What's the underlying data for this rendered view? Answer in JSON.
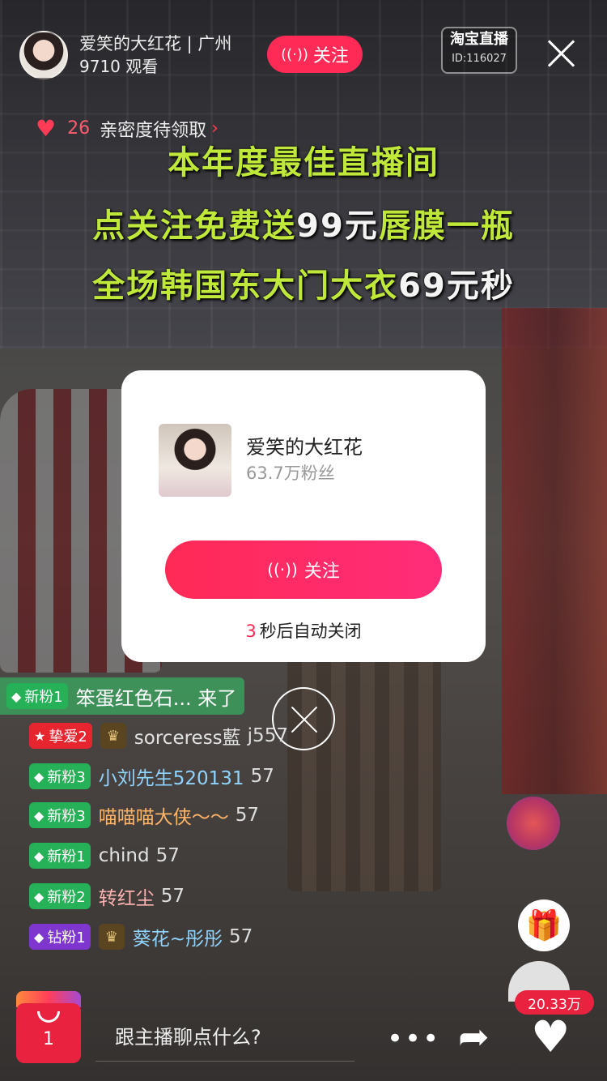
{
  "host": {
    "name": "爱笑的大红花 | 广州",
    "viewers": "9710 观看",
    "follow_label": "关注"
  },
  "platform": {
    "logo_text": "淘宝直播",
    "room_id": "ID:116027"
  },
  "intimacy": {
    "count": "26",
    "text": "亲密度待领取"
  },
  "banner": {
    "line1": "本年度最佳直播间",
    "line2_a": "点关注免费送",
    "line2_b": "99元",
    "line2_c": "唇膜一瓶",
    "line3_a": "全场韩国东大门大衣",
    "line3_b": "69元秒"
  },
  "modal": {
    "name": "爱笑的大红花",
    "fans": "63.7万粉丝",
    "follow_label": "关注",
    "countdown": "3",
    "countdown_text": "秒后自动关闭"
  },
  "chat": {
    "first": {
      "badge": "新粉1",
      "text": "笨蛋红色石... 来了"
    },
    "messages": [
      {
        "badge": "挚爱2",
        "user": "sorceress藍",
        "score": "j557"
      },
      {
        "badge": "新粉3",
        "user": "小刘先生520131",
        "score": "57"
      },
      {
        "badge": "新粉3",
        "user": "喵喵喵大侠～～",
        "score": "57"
      },
      {
        "badge": "新粉1",
        "user": "chind",
        "score": "57"
      },
      {
        "badge": "新粉2",
        "user": "转红尘",
        "score": "57"
      },
      {
        "badge": "钻粉1",
        "user": "葵花~彤彤",
        "score": "57"
      }
    ]
  },
  "likes": "20.33万",
  "cart_count": "1",
  "input_placeholder": "跟主播聊点什么?",
  "colors": {
    "accent": "#ff2a55",
    "fan_green": "#26b057",
    "love_red": "#e6252e",
    "diamond_purple": "#7f36cf",
    "banner_text": "#bfe83a"
  }
}
